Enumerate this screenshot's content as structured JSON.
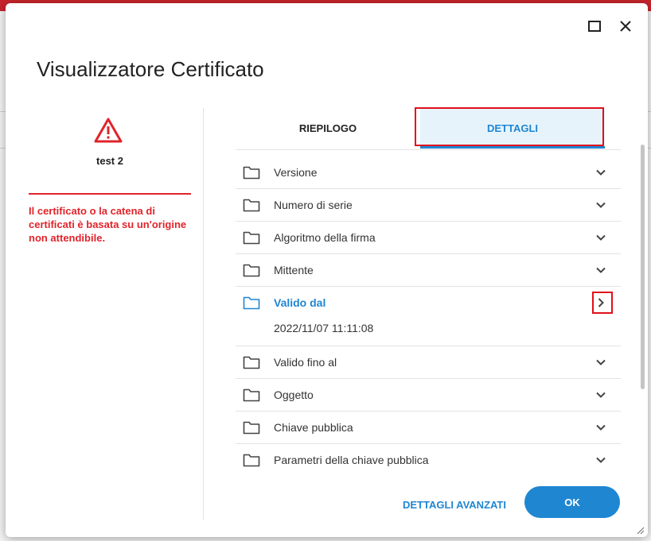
{
  "dialog": {
    "title": "Visualizzatore Certificato"
  },
  "window_controls": {
    "maximize_icon": "maximize-icon",
    "close_icon": "close-icon"
  },
  "left_panel": {
    "icon": "warning-icon",
    "name": "test 2",
    "warning_text": "Il certificato o la catena di certificati è basata su un'origine non attendibile."
  },
  "tabs": [
    {
      "label": "RIEPILOGO",
      "active": false
    },
    {
      "label": "DETTAGLI",
      "active": true
    }
  ],
  "details": [
    {
      "label": "Versione",
      "expanded": false
    },
    {
      "label": "Numero di serie",
      "expanded": false
    },
    {
      "label": "Algoritmo della firma",
      "expanded": false
    },
    {
      "label": "Mittente",
      "expanded": false
    },
    {
      "label": "Valido dal",
      "expanded": true,
      "value": "2022/11/07 11:11:08"
    },
    {
      "label": "Valido fino al",
      "expanded": false
    },
    {
      "label": "Oggetto",
      "expanded": false
    },
    {
      "label": "Chiave pubblica",
      "expanded": false
    },
    {
      "label": "Parametri della chiave pubblica",
      "expanded": false
    }
  ],
  "buttons": {
    "advanced": "DETTAGLI AVANZATI",
    "ok": "OK"
  },
  "colors": {
    "accent": "#1f86d2",
    "warning": "#e0242b",
    "highlight": "#e0101c"
  }
}
